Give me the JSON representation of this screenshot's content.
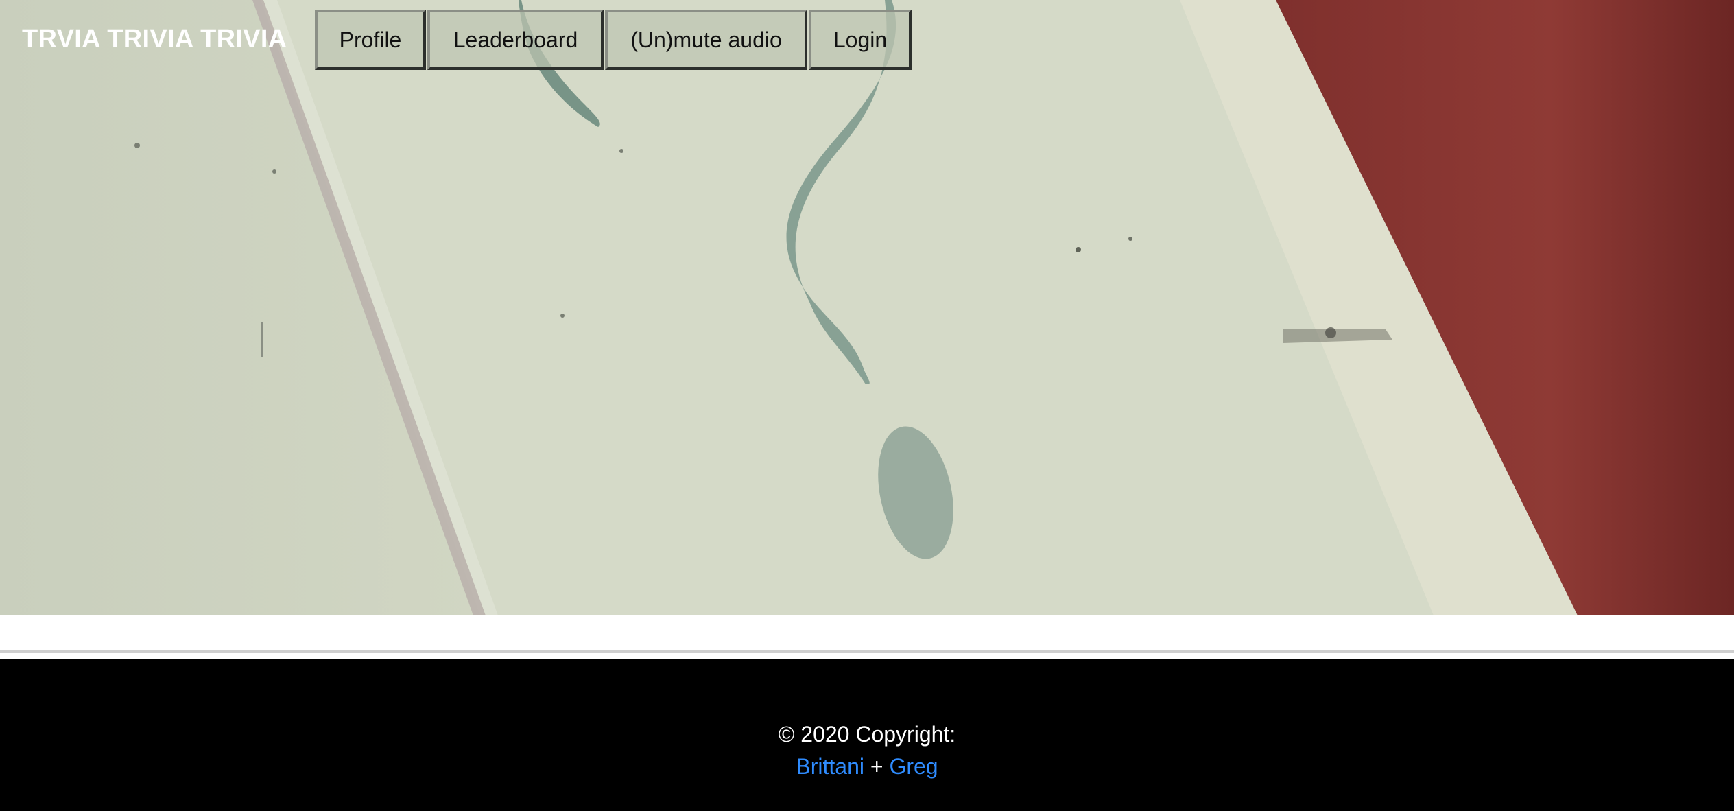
{
  "navbar": {
    "brand": "TRVIA TRIVIA TRIVIA",
    "buttons": {
      "profile": "Profile",
      "leaderboard": "Leaderboard",
      "mute": "(Un)mute audio",
      "login": "Login"
    }
  },
  "hero": {
    "image": "question-mark-sign-background"
  },
  "footer": {
    "copyright": "© 2020 Copyright:",
    "author1": "Brittani",
    "separator": "+",
    "author2": "Greg"
  },
  "colors": {
    "footer_bg": "#000000",
    "link": "#2f8cff",
    "sign_red": "#8a3430",
    "sign_cream": "#d4d9c6",
    "glyph": "#7f9a8e"
  }
}
